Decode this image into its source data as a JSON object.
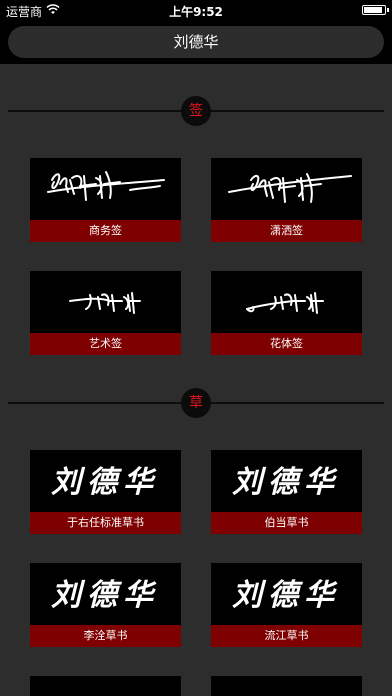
{
  "status_bar": {
    "carrier": "运营商",
    "time": "上午9:52",
    "battery_level": 0.9
  },
  "header": {
    "title": "刘德华"
  },
  "sections": [
    {
      "badge": "签",
      "items": [
        {
          "label": "商务签"
        },
        {
          "label": "潇洒签"
        },
        {
          "label": "艺术签"
        },
        {
          "label": "花体签"
        }
      ]
    },
    {
      "badge": "草",
      "items": [
        {
          "label": "于右任标准草书",
          "preview": "刘德华"
        },
        {
          "label": "伯当草书",
          "preview": "刘德华"
        },
        {
          "label": "李洤草书",
          "preview": "刘德华"
        },
        {
          "label": "流江草书",
          "preview": "刘德华"
        }
      ]
    }
  ],
  "colors": {
    "accent_red": "#e3141b",
    "label_bg": "#7f0000",
    "page_bg": "#2d2d2d"
  },
  "icons": [
    "wifi-icon",
    "battery-icon"
  ]
}
